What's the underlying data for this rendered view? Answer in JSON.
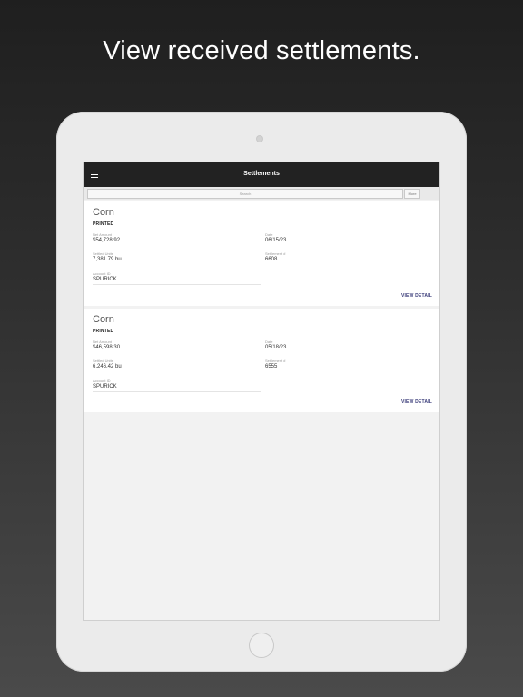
{
  "promo": {
    "headline": "View received settlements."
  },
  "appbar": {
    "title": "Settlements",
    "menu_icon": "hamburger-icon"
  },
  "filter": {
    "placeholder": "Search",
    "more_label": "More"
  },
  "settlements": [
    {
      "commodity": "Corn",
      "status": "PRINTED",
      "net_amount_label": "Net Amount",
      "net_amount": "$54,728.92",
      "date_label": "Date",
      "date": "06/15/23",
      "settled_label": "Settled Units",
      "settled_units": "7,381.79 bu",
      "settlement_no_label": "Settlement #",
      "settlement_no": "6608",
      "account_label": "Account ID",
      "account_id": "SPURICK",
      "action_label": "VIEW DETAIL"
    },
    {
      "commodity": "Corn",
      "status": "PRINTED",
      "net_amount_label": "Net Amount",
      "net_amount": "$46,598.30",
      "date_label": "Date",
      "date": "05/18/23",
      "settled_label": "Settled Units",
      "settled_units": "6,246.42 bu",
      "settlement_no_label": "Settlement #",
      "settlement_no": "6555",
      "account_label": "Account ID",
      "account_id": "SPURICK",
      "action_label": "VIEW DETAIL"
    }
  ],
  "colors": {
    "appbar": "#222222",
    "action": "#3b3d7a",
    "background_top": "#1f1f1f",
    "background_bottom": "#4a4a4a"
  }
}
